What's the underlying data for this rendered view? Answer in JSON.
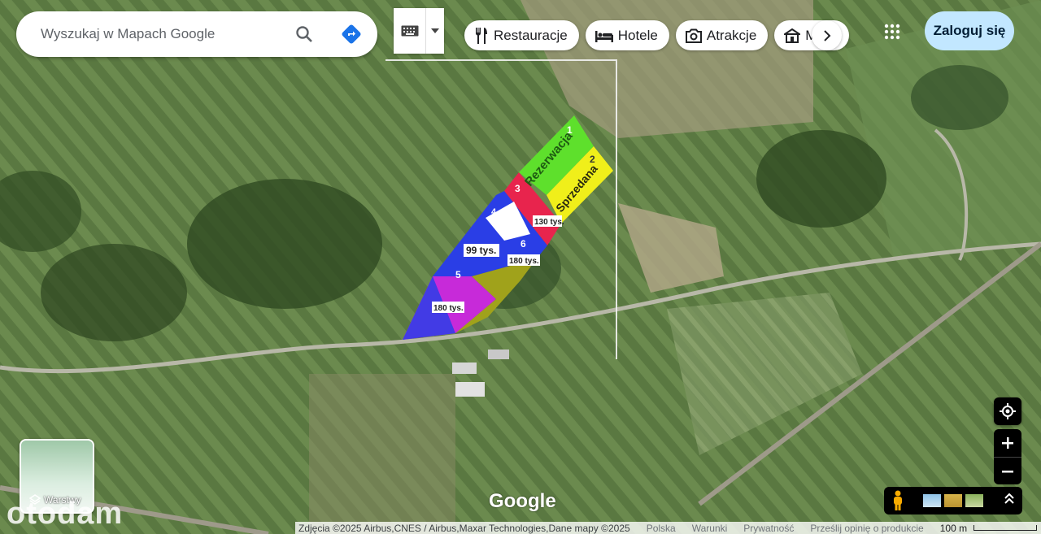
{
  "search": {
    "placeholder": "Wyszukaj w Mapach Google"
  },
  "chips": [
    {
      "label": "Restauracje",
      "icon": "fork-knife-icon"
    },
    {
      "label": "Hotele",
      "icon": "bed-icon"
    },
    {
      "label": "Atrakcje",
      "icon": "camera-icon"
    },
    {
      "label": "M",
      "icon": "museum-icon"
    }
  ],
  "signin": {
    "label": "Zaloguj się"
  },
  "layers": {
    "label": "Warstwy"
  },
  "watermark": {
    "text": "otodam"
  },
  "google_logo": "Google",
  "footer": {
    "imagery": "Zdjęcia ©2025 Airbus,CNES / Airbus,Maxar Technologies,Dane mapy ©2025",
    "country": "Polska",
    "terms": "Warunki",
    "privacy": "Prywatność",
    "feedback": "Prześlij opinię o produkcie",
    "scale": "100 m"
  },
  "plots": {
    "p1": {
      "number": "1",
      "status": "Rezerwacja",
      "color": "#5ee02c"
    },
    "p2": {
      "number": "2",
      "status": "Sprzedana",
      "color": "#f0ef1a"
    },
    "p3": {
      "number": "3",
      "price": "130 tys.",
      "color": "#e8244d"
    },
    "p4": {
      "number": "4",
      "price": "99 tys.",
      "color": "#2a3ee6"
    },
    "p5": {
      "number": "5",
      "price": "180 tys.",
      "color": "#c72ad9"
    },
    "p6": {
      "number": "6",
      "price": "180 tys.",
      "color": "#a0a21b"
    }
  }
}
